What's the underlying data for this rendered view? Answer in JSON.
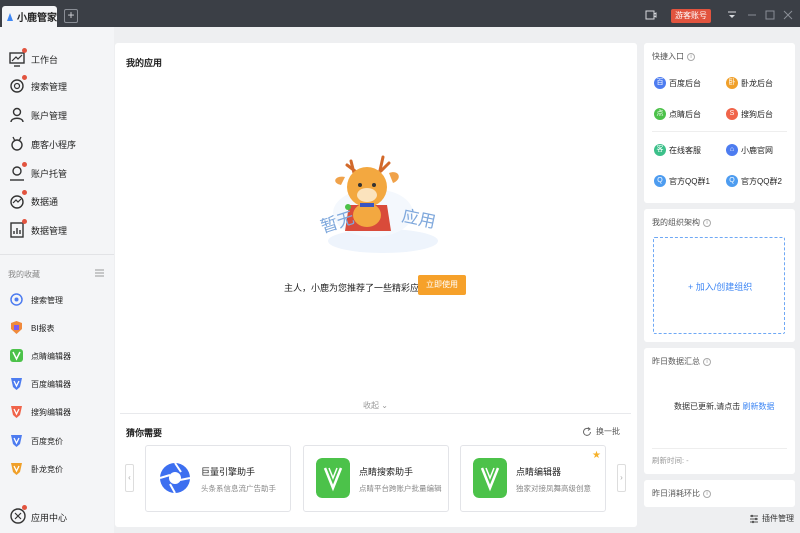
{
  "titlebar": {
    "app_name": "小鹿管家",
    "add_tab": "+",
    "guest_label": "游客账号"
  },
  "sidebar": {
    "items": [
      {
        "label": "工作台",
        "icon": "dashboard-icon",
        "badge": true
      },
      {
        "label": "搜索管理",
        "icon": "search-manage-icon",
        "badge": true
      },
      {
        "label": "账户管理",
        "icon": "account-icon",
        "badge": false
      },
      {
        "label": "鹿客小程序",
        "icon": "deer-miniapp-icon",
        "badge": false
      },
      {
        "label": "账户托管",
        "icon": "account-hosting-icon",
        "badge": true
      },
      {
        "label": "数据通",
        "icon": "data-link-icon",
        "badge": true
      },
      {
        "label": "数据管理",
        "icon": "data-manage-icon",
        "badge": true
      }
    ],
    "favorites_header": "我的收藏",
    "favorites": [
      {
        "label": "搜索管理",
        "color": "#4d7cf0"
      },
      {
        "label": "BI报表",
        "color": "#f08a3c"
      },
      {
        "label": "点睛编辑器",
        "color": "#4cc24a"
      },
      {
        "label": "百度编辑器",
        "color": "#4d7cf0"
      },
      {
        "label": "搜狗编辑器",
        "color": "#f0644a"
      },
      {
        "label": "百度竞价",
        "color": "#4d7cf0"
      },
      {
        "label": "卧龙竞价",
        "color": "#f0a02a"
      }
    ],
    "app_center": "应用中心"
  },
  "main": {
    "title": "我的应用",
    "empty_label": "暂无应用",
    "empty_text": "主人，小鹿为您推荐了一些精彩应用",
    "use_button": "立即使用",
    "collapse": "收起",
    "guess_title": "猜你需要",
    "refresh": "换一批",
    "prev": "‹",
    "next": "›",
    "cards": [
      {
        "title": "巨量引擎助手",
        "desc": "头条系信息流广告助手",
        "color": "#3d6ff0",
        "star": false
      },
      {
        "title": "点睛搜索助手",
        "desc": "点睛平台跨账户批量编辑",
        "color": "#4cc24a",
        "star": false
      },
      {
        "title": "点睛编辑器",
        "desc": "独家对接凤舞高级创意",
        "color": "#4cc24a",
        "star": true
      }
    ]
  },
  "right": {
    "quick": {
      "title": "快捷入口",
      "items": [
        {
          "label": "百度后台",
          "color": "#4d7cf0",
          "glyph": "百"
        },
        {
          "label": "卧龙后台",
          "color": "#f0a02a",
          "glyph": "卧"
        },
        {
          "label": "点睛后台",
          "color": "#4cc24a",
          "glyph": "点"
        },
        {
          "label": "搜狗后台",
          "color": "#f0644a",
          "glyph": "S"
        },
        {
          "label": "在线客服",
          "color": "#3cc08a",
          "glyph": "客"
        },
        {
          "label": "小鹿官网",
          "color": "#4d7cf0",
          "glyph": "⌂"
        },
        {
          "label": "官方QQ群1",
          "color": "#4d9cf0",
          "glyph": "Q"
        },
        {
          "label": "官方QQ群2",
          "color": "#4d9cf0",
          "glyph": "Q"
        }
      ]
    },
    "org": {
      "title": "我的组织架构",
      "add_label": "+ 加入/创建组织"
    },
    "yesterday": {
      "title": "昨日数据汇总",
      "text": "数据已更新,请点击",
      "link": "刷新数据",
      "refresh_time": "刷新时间: -"
    },
    "compare": {
      "title": "昨日消耗环比"
    }
  },
  "plugin_label": "插件管理"
}
